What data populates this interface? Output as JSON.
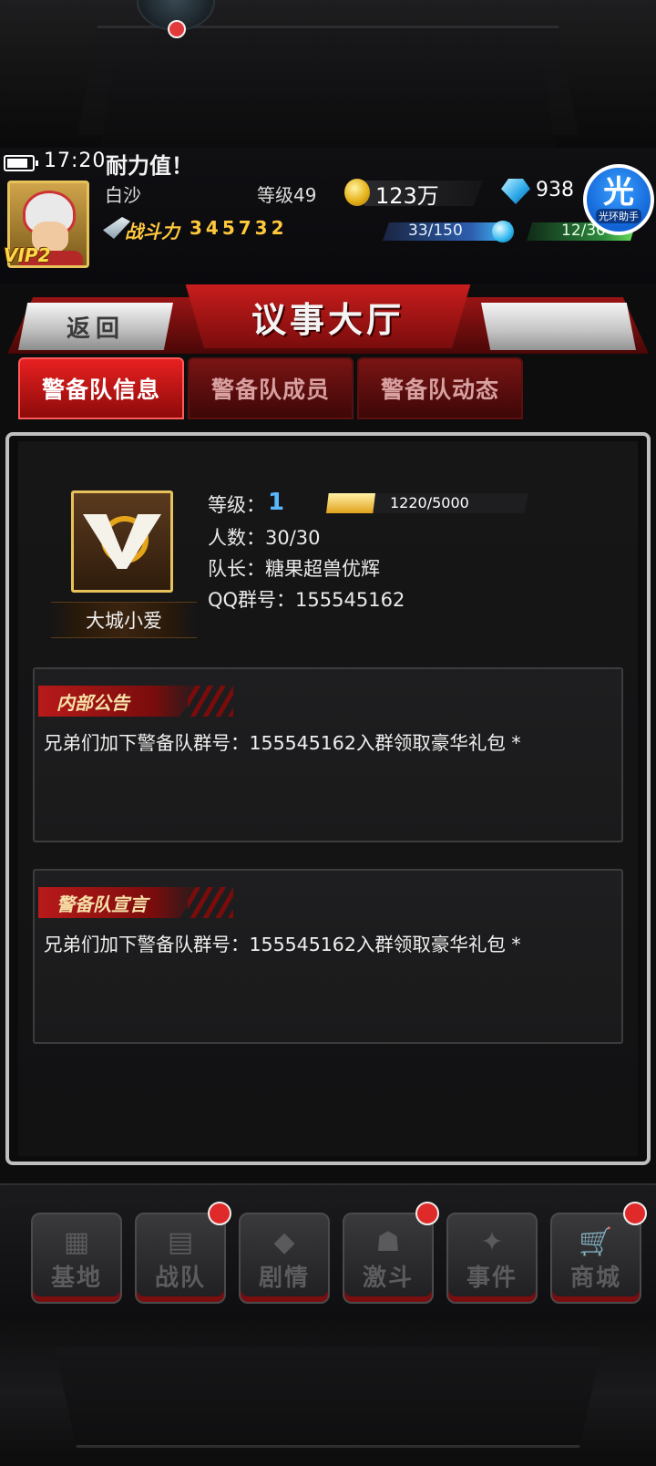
{
  "status": {
    "time": "17:20",
    "stamina_message": "耐力值！"
  },
  "player": {
    "name": "白沙",
    "level": "等级49",
    "vip": "VIP2",
    "coins": "123万",
    "gems": "938",
    "power_label": "战斗力",
    "power_value": "345732",
    "energy": "33/150",
    "stamina": "12/30"
  },
  "assistant": {
    "glyph": "光",
    "label": "光环助手"
  },
  "header": {
    "back_label": "返回",
    "title": "议事大厅"
  },
  "tabs": [
    {
      "label": "警备队信息",
      "active": true
    },
    {
      "label": "警备队成员",
      "active": false
    },
    {
      "label": "警备队动态",
      "active": false
    }
  ],
  "team": {
    "name": "大城小爱",
    "level_label": "等级：",
    "level_value": "1",
    "exp_text": "1220/5000",
    "exp_fraction": 0.244,
    "members": "人数：30/30",
    "captain": "队长：糖果超兽优辉",
    "qq": "QQ群号：155545162"
  },
  "notices": {
    "internal_title": "内部公告",
    "internal_text": "兄弟们加下警备队群号：155545162入群领取豪华礼包 *",
    "declaration_title": "警备队宣言",
    "declaration_text": "兄弟们加下警备队群号：155545162入群领取豪华礼包 *"
  },
  "nav": [
    {
      "label": "基地",
      "icon": "base-icon",
      "badge": false
    },
    {
      "label": "战队",
      "icon": "team-icon",
      "badge": true
    },
    {
      "label": "剧情",
      "icon": "story-icon",
      "badge": false
    },
    {
      "label": "激斗",
      "icon": "battle-icon",
      "badge": true
    },
    {
      "label": "事件",
      "icon": "event-icon",
      "badge": false
    },
    {
      "label": "商城",
      "icon": "shop-cart-icon",
      "badge": true
    }
  ],
  "colors": {
    "accent_red": "#c81d1d",
    "gold": "#e7c25a",
    "level_blue": "#5ab8ff",
    "power_gold": "#ffc83d"
  }
}
